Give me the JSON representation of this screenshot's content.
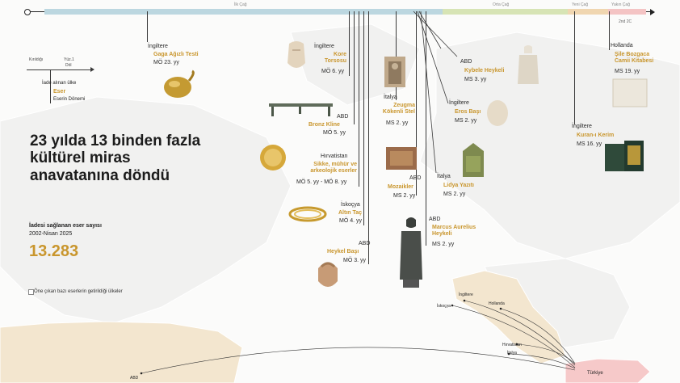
{
  "timeline": {
    "eras": [
      {
        "label": "İlk Çağ",
        "color": "#bcd7e0"
      },
      {
        "label": "Orta Çağ",
        "color": "#d7e4b5"
      },
      {
        "label": "Yeni Çağ",
        "color": "#f0d6b0"
      },
      {
        "label": "Yakın Çağ",
        "color": "#f4c4c4"
      }
    ],
    "end_year": "2nd 2C",
    "extra_year": "2nd 1C"
  },
  "legend_key": {
    "a": "Kırıldığı",
    "b": "Yüz.1",
    "c": "Döl",
    "iade": "İade alınan ülke",
    "eser": "Eser",
    "donem": "Eserin Dönemi"
  },
  "headline": "23 yılda 13 binden fazla kültürel miras anavatanına döndü",
  "stat": {
    "label": "İadesi sağlanan eser sayısı",
    "period": "2002-Nisan 2025",
    "value": "13.283"
  },
  "map_note": "Öne çıkan bazı eserlerin getirildiği ülkeler",
  "artifacts": [
    {
      "country": "İngiltere",
      "name": "Gaga Ağızlı Testi",
      "date": "MÖ 23. yy"
    },
    {
      "country": "İngiltere",
      "name": "Kore Torsosu",
      "date": "MÖ 6. yy"
    },
    {
      "country": "ABD",
      "name": "Bronz Kline",
      "date": "MÖ 5. yy"
    },
    {
      "country": "Hırvatistan",
      "name": "Sikke, mühür ve arkeolojik eserler",
      "date": "MÖ 5. yy - MÖ 8. yy"
    },
    {
      "country": "İskoçya",
      "name": "Altın Taç",
      "date": "MÖ 4. yy"
    },
    {
      "country": "ABD",
      "name": "Heykel Başı",
      "date": "MÖ 3. yy"
    },
    {
      "country": "İtalya",
      "name": "Zeugma Kökenli Stel",
      "date": "MS 2. yy"
    },
    {
      "country": "ABD",
      "name": "Mozaikler",
      "date": "MS 2. yy"
    },
    {
      "country": "ABD",
      "name": "Marcus Aurelius Heykeli",
      "date": "MS 2. yy"
    },
    {
      "country": "ABD",
      "name": "Kybele Heykeli",
      "date": "MS 3. yy"
    },
    {
      "country": "İngiltere",
      "name": "Eros Başı",
      "date": "MS 2. yy"
    },
    {
      "country": "İtalya",
      "name": "Lidya Yazıtı",
      "date": "MS 2. yy"
    },
    {
      "country": "İngiltere",
      "name": "Kuran-ı Kerim",
      "date": "MS 16. yy"
    },
    {
      "country": "Hollanda",
      "name": "Şile Bozgaca Camii Kitabesi",
      "date": "MS 19. yy"
    }
  ],
  "map_labels": {
    "abd": "ABD",
    "ingiltere": "İngiltere",
    "hollanda": "Hollanda",
    "iskocya": "İskoçya",
    "hirvatistan": "Hırvatistan",
    "italya": "İtalya",
    "turkiye": "Türkiye"
  },
  "colors": {
    "accent": "#c9962d",
    "text": "#1c1c1c",
    "turkey": "#f6c9c9",
    "land": "#ececec",
    "highlight_land": "#f3e6cf"
  }
}
